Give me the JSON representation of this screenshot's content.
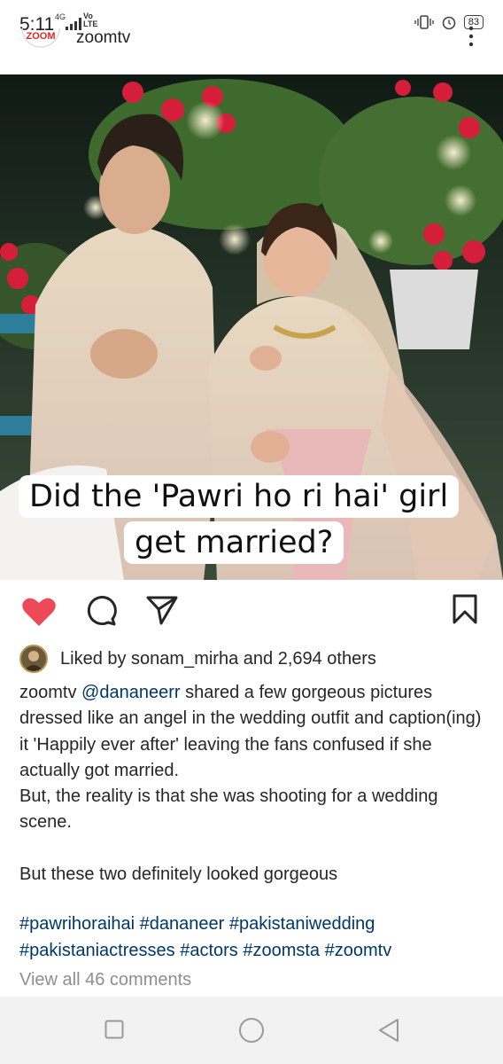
{
  "status_bar": {
    "time": "5:11",
    "network": "4G",
    "volte": "Vo\nLTE",
    "battery": "83"
  },
  "header": {
    "logo_text": "ZOOM",
    "username": "zoomtv"
  },
  "post": {
    "overlay_line1": "Did the 'Pawri ho ri hai' girl",
    "overlay_line2": "get married?"
  },
  "actions": {
    "liked": true,
    "like_color": "#ed4956"
  },
  "likes": {
    "text": "Liked by sonam_mirha and 2,694 others"
  },
  "caption": {
    "username": "zoomtv",
    "mention": "@dananeerr",
    "text1": " shared a few gorgeous pictures dressed like an angel in the wedding outfit and caption(ing) it 'Happily ever after' leaving the fans confused if she actually got married.",
    "text2": "But, the reality is that she was shooting for a wedding scene.",
    "text3": "But these two definitely looked gorgeous"
  },
  "hashtags": {
    "line1": "#pawrihoraihai #dananeer #pakistaniwedding",
    "line2": "#pakistaniactresses #actors #zoomsta #zoomtv"
  },
  "comments": {
    "view_all": "View all 46 comments"
  },
  "colors": {
    "link": "#00376b",
    "muted": "#8e8e8e",
    "text": "#262626"
  }
}
